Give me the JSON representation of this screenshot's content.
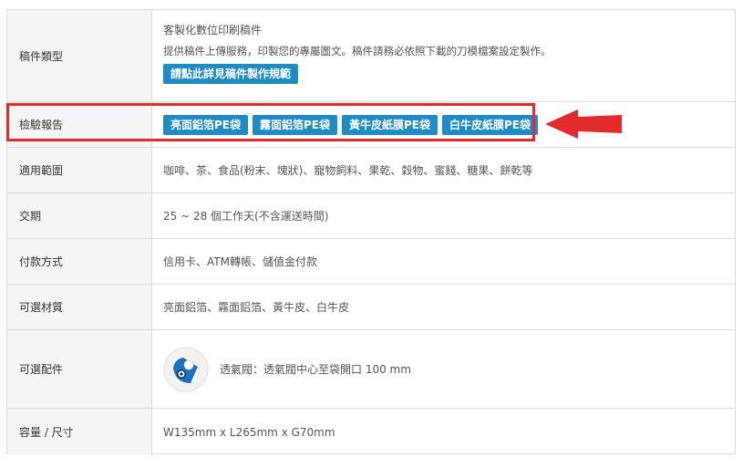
{
  "rows": {
    "type": {
      "label": "稿件類型",
      "line1": "客製化數位印刷稿件",
      "line2": "提供稿件上傳服務，印製您的專屬圖文。稿件請務必依照下載的刀模檔案設定製作。",
      "button": "請點此詳見稿件製作規範"
    },
    "report": {
      "label": "檢驗報告",
      "buttons": [
        "亮面鋁箔PE袋",
        "霧面鋁箔PE袋",
        "黃牛皮紙膜PE袋",
        "白牛皮紙膜PE袋"
      ]
    },
    "scope": {
      "label": "適用範圍",
      "value": "咖啡、茶、食品(粉末、塊狀)、寵物飼料、果乾、穀物、蜜餞、糖果、餅乾等"
    },
    "delivery": {
      "label": "交期",
      "value": "25 ~ 28 個工作天(不含運送時間)"
    },
    "payment": {
      "label": "付款方式",
      "value": "信用卡、ATM轉帳、儲值金付款"
    },
    "material": {
      "label": "可選材質",
      "value": "亮面鋁箔、霧面鋁箔、黃牛皮、白牛皮"
    },
    "accessory": {
      "label": "可選配件",
      "icon": "degassing-valve-icon",
      "value": "透氣閥：透氣閥中心至袋開口 100 mm"
    },
    "size": {
      "label": "容量 / 尺寸",
      "value": "W135mm x L265mm x G70mm"
    }
  },
  "colors": {
    "button": "#1e8bc3",
    "highlight": "#e52a2a",
    "label_bg": "#f5f5f5",
    "border": "#dddddd"
  }
}
